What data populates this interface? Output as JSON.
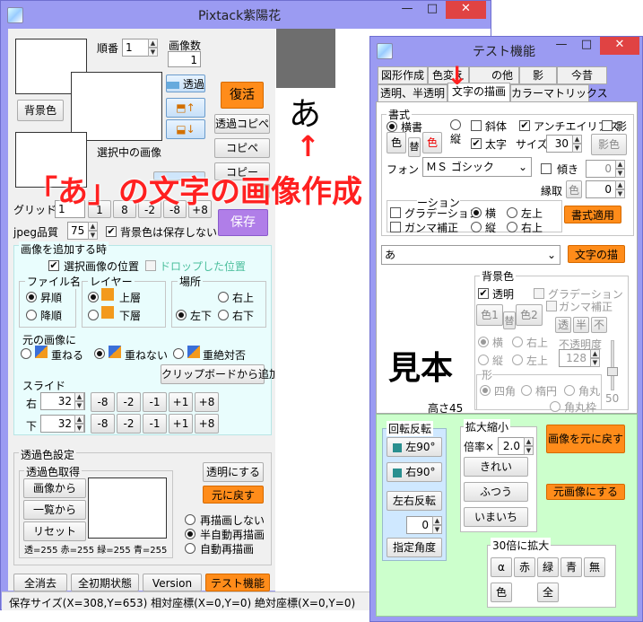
{
  "annotation": {
    "arrow": "↑",
    "arrow_down": "↓",
    "caption": "「あ」の文字の画像作成",
    "sample_char": "あ"
  },
  "main_window": {
    "title": "Pixtack紫陽花",
    "controls": {
      "minimize": "—",
      "maximize": "□",
      "close": "✕"
    },
    "top_section": {
      "order_label": "順番",
      "order_value": "1",
      "image_count_label": "画像数",
      "image_count_value": "1",
      "bg_color_button": "背景色",
      "transparent_button": "透過",
      "selected_image_label": "選択中の画像",
      "restore_button": "復活",
      "transparent_copy_button": "透過コピペ",
      "copy_paste_button": "コピペ",
      "copy_button": "コピー",
      "save_button": "保存"
    },
    "grid": {
      "label": "グリッド",
      "value": "1",
      "buttons": [
        "1",
        "8",
        "-2",
        "-8",
        "+8"
      ]
    },
    "jpeg": {
      "label": "jpeg品質",
      "value": "75",
      "bg_not_saved_label": "背景色は保存しない"
    },
    "add_image": {
      "title": "画像を追加する時",
      "selected_position": "選択画像の位置",
      "dropped_position": "ドロップした位置",
      "filename_group": "ファイル名",
      "ascending": "昇順",
      "descending": "降順",
      "layer_group": "レイヤー",
      "top_layer": "上層",
      "bottom_layer": "下層",
      "location_group": "場所",
      "top_right": "右上",
      "bottom_left": "左下",
      "bottom_right": "右下",
      "original_group": "元の画像に",
      "overlap": "重ねる",
      "no_overlap": "重ねない",
      "absolute_no_overlap": "重絶対否",
      "add_from_clipboard": "クリップボードから追加",
      "slide_group": "スライド",
      "right_label": "右",
      "right_value": "32",
      "down_label": "下",
      "down_value": "32",
      "slide_buttons": [
        "-8",
        "-2",
        "-1",
        "+1",
        "+8"
      ]
    },
    "transparency": {
      "title": "透過色設定",
      "get_group": "透過色取得",
      "from_image": "画像から",
      "from_list": "一覧から",
      "reset": "リセット",
      "make_transparent": "透明にする",
      "restore": "元に戻す",
      "no_redraw": "再描画しない",
      "semi_auto_redraw": "半自動再描画",
      "auto_redraw": "自動再描画",
      "rgba": "透=255 赤=255 緑=255 青=255"
    },
    "bottom_buttons": {
      "clear_all": "全消去",
      "initial_state": "全初期状態",
      "version": "Version",
      "test_function": "テスト機能"
    },
    "status_bar": "保存サイズ(X=308,Y=653)  相対座標(X=0,Y=0)  絶対座標(X=0,Y=0)"
  },
  "test_window": {
    "title": "テスト機能",
    "controls": {
      "minimize": "—",
      "maximize": "□",
      "close": "✕"
    },
    "tabs_row1": [
      "図形作成",
      "色変え",
      "の他",
      "影",
      "今昔"
    ],
    "tabs_row2": [
      "透明、半透明",
      "文字の描画",
      "カラーマトリックス"
    ],
    "format": {
      "title": "書式",
      "horizontal": "横書",
      "vertical": "縦",
      "italic": "斜体",
      "antialias": "アンチエイリアス",
      "shadow": "影",
      "color_button": "色",
      "swap_button": "替",
      "color2_button": "色",
      "bold": "太字",
      "size_label": "サイズ",
      "size_value": "30",
      "shadow_color_button": "影色",
      "font_label": "フォント",
      "font_value": "ＭＳ ゴシック",
      "tilt_label": "傾き",
      "tilt_value": "0",
      "border_label": "縁取",
      "border_color_button": "色",
      "border_value": "0",
      "gradation_group": "ーション",
      "gradation": "グラデーション",
      "horiz": "横",
      "top_left": "左上",
      "gamma": "ガンマ補正",
      "vert": "縦",
      "top_right": "右上",
      "apply_format": "書式適用"
    },
    "text_input": {
      "value": "あ",
      "draw_button": "文字の描"
    },
    "background": {
      "title": "背景色",
      "transparent": "透明",
      "gradation": "グラデーション",
      "gamma": "ガンマ補正",
      "color1": "色1",
      "swap": "替",
      "color2": "色2",
      "trans": "透",
      "half": "半",
      "opaque": "不",
      "horiz": "横",
      "top_right": "右上",
      "opacity_label": "不透明度",
      "vert": "縦",
      "top_left": "左上",
      "opacity_value": "128",
      "shape_group": "形",
      "square": "四角",
      "ellipse": "楕円",
      "rounded": "角丸",
      "rounded2": "角丸枠",
      "height_label": "高さ45",
      "slider_value": "50"
    },
    "sample_text": "見本",
    "rotate": {
      "title": "回転反転",
      "left90": "左90°",
      "right90": "右90°",
      "flip_lr": "左右反転",
      "angle_value": "0",
      "set_angle": "指定角度"
    },
    "scale": {
      "title": "拡大縮小",
      "ratio_label": "倍率×",
      "ratio_value": "2.0",
      "pretty": "きれい",
      "normal": "ふつう",
      "poor": "いまいち"
    },
    "restore_image": "画像を元に戻す",
    "original_image": "元画像にする",
    "zoom30": {
      "title": "30倍に拡大",
      "buttons": [
        "α",
        "赤",
        "緑",
        "青",
        "無"
      ],
      "color": "色",
      "all": "全"
    }
  },
  "colors": {
    "accent_orange": "#ff8c1a",
    "title_purple": "#9b9bf2",
    "annotation_red": "#ff2020",
    "panel_cyan": "#e9fdfd",
    "panel_green": "#ccffcc"
  }
}
